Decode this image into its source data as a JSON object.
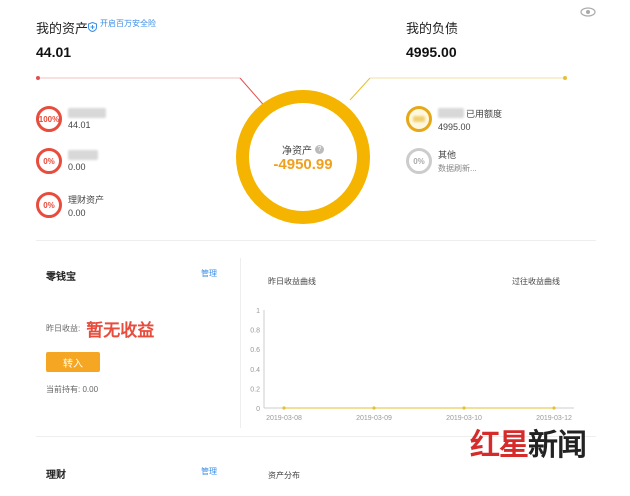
{
  "assets": {
    "title": "我的资产",
    "security_link": "开启百万安全险",
    "total": "44.01",
    "items": [
      {
        "percent": "100%",
        "label": "",
        "value": "44.01"
      },
      {
        "percent": "0%",
        "label": "",
        "value": "0.00"
      },
      {
        "percent": "0%",
        "label": "理财资产",
        "value": "0.00"
      }
    ]
  },
  "liabilities": {
    "title": "我的负债",
    "total": "4995.00",
    "items": [
      {
        "percent": "",
        "label": "已用额度",
        "value": "4995.00"
      },
      {
        "percent": "0%",
        "label": "其他",
        "value": "数据刷新..."
      }
    ]
  },
  "net_assets": {
    "label": "净资产",
    "value": "-4950.99"
  },
  "yuebao": {
    "title": "零钱宝",
    "manage": "管理",
    "yesterday_label": "昨日收益:",
    "yesterday_value": "暂无收益",
    "transfer_in": "转入",
    "holding_label": "当前持有: 0.00"
  },
  "income_chart": {
    "title": "昨日收益曲线",
    "right_label": "过往收益曲线",
    "chart_data": {
      "type": "line",
      "x": [
        "2019-03-08",
        "2019-03-09",
        "2019-03-10",
        "2019-03-12"
      ],
      "series": [
        {
          "values": [
            0,
            0,
            0,
            0
          ]
        }
      ],
      "yticks": [
        "1",
        "0.8",
        "0.6",
        "0.4",
        "0.2",
        "0"
      ],
      "ylim": [
        0,
        1
      ]
    }
  },
  "licai": {
    "title": "理财",
    "manage": "管理",
    "distribution": "资产分布"
  },
  "watermark": {
    "red": "红星",
    "black": "新闻"
  },
  "colors": {
    "ring": "#f5b400",
    "net_value": "#f0a020",
    "red_accent": "#e74c3c",
    "blue_link": "#3a8ee6"
  }
}
